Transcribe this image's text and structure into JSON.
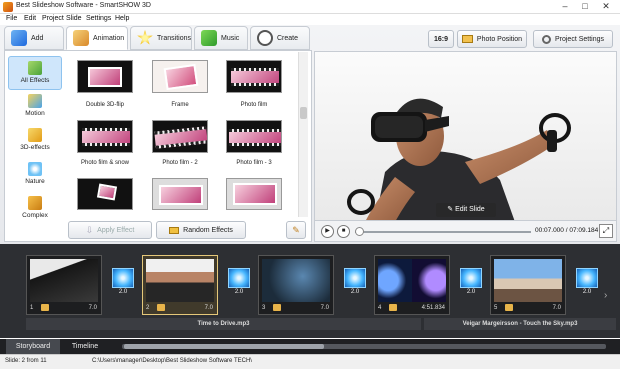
{
  "window": {
    "title": "Best Slideshow Software - SmartSHOW 3D"
  },
  "menu": [
    "File",
    "Edit",
    "Project",
    "Slide",
    "Settings",
    "Help"
  ],
  "tabs": [
    {
      "label": "Add"
    },
    {
      "label": "Animation"
    },
    {
      "label": "Transitions"
    },
    {
      "label": "Music"
    },
    {
      "label": "Create"
    }
  ],
  "toolbar": {
    "aspect": "16:9",
    "photo_position": "Photo Position",
    "project_settings": "Project Settings"
  },
  "categories": [
    "All Effects",
    "Motion",
    "3D-effects",
    "Nature",
    "Complex"
  ],
  "effects": [
    "Double 3D-flip",
    "Frame",
    "Photo film",
    "Photo film & snow",
    "Photo film - 2",
    "Photo film - 3",
    "",
    "",
    ""
  ],
  "actions": {
    "apply": "Apply Effect",
    "random": "Random Effects"
  },
  "preview": {
    "edit_slide": "Edit Slide",
    "time": "00:07.000 / 07:09.184"
  },
  "slides": [
    {
      "num": "1",
      "dur": "7.0"
    },
    {
      "num": "2",
      "dur": "7.0"
    },
    {
      "num": "3",
      "dur": "7.0"
    },
    {
      "num": "4",
      "dur": "4:51.834"
    },
    {
      "num": "5",
      "dur": "7.0"
    }
  ],
  "transitions": [
    "2.0",
    "2.0",
    "2.0",
    "2.0",
    "2.0"
  ],
  "audio": [
    "Time to Drive.mp3",
    "Veigar Margeirsson - Touch the Sky.mp3"
  ],
  "bottom_tabs": [
    "Storyboard",
    "Timeline"
  ],
  "status": {
    "slide": "Slide: 2 from 11",
    "path": "C:\\Users\\manager\\Desktop\\Best Slideshow Software TECH\\"
  },
  "colors": {
    "accent": "#2a8fe0",
    "selected_slide": "#e5c87a",
    "storyboard_bg": "#2d2f33"
  }
}
